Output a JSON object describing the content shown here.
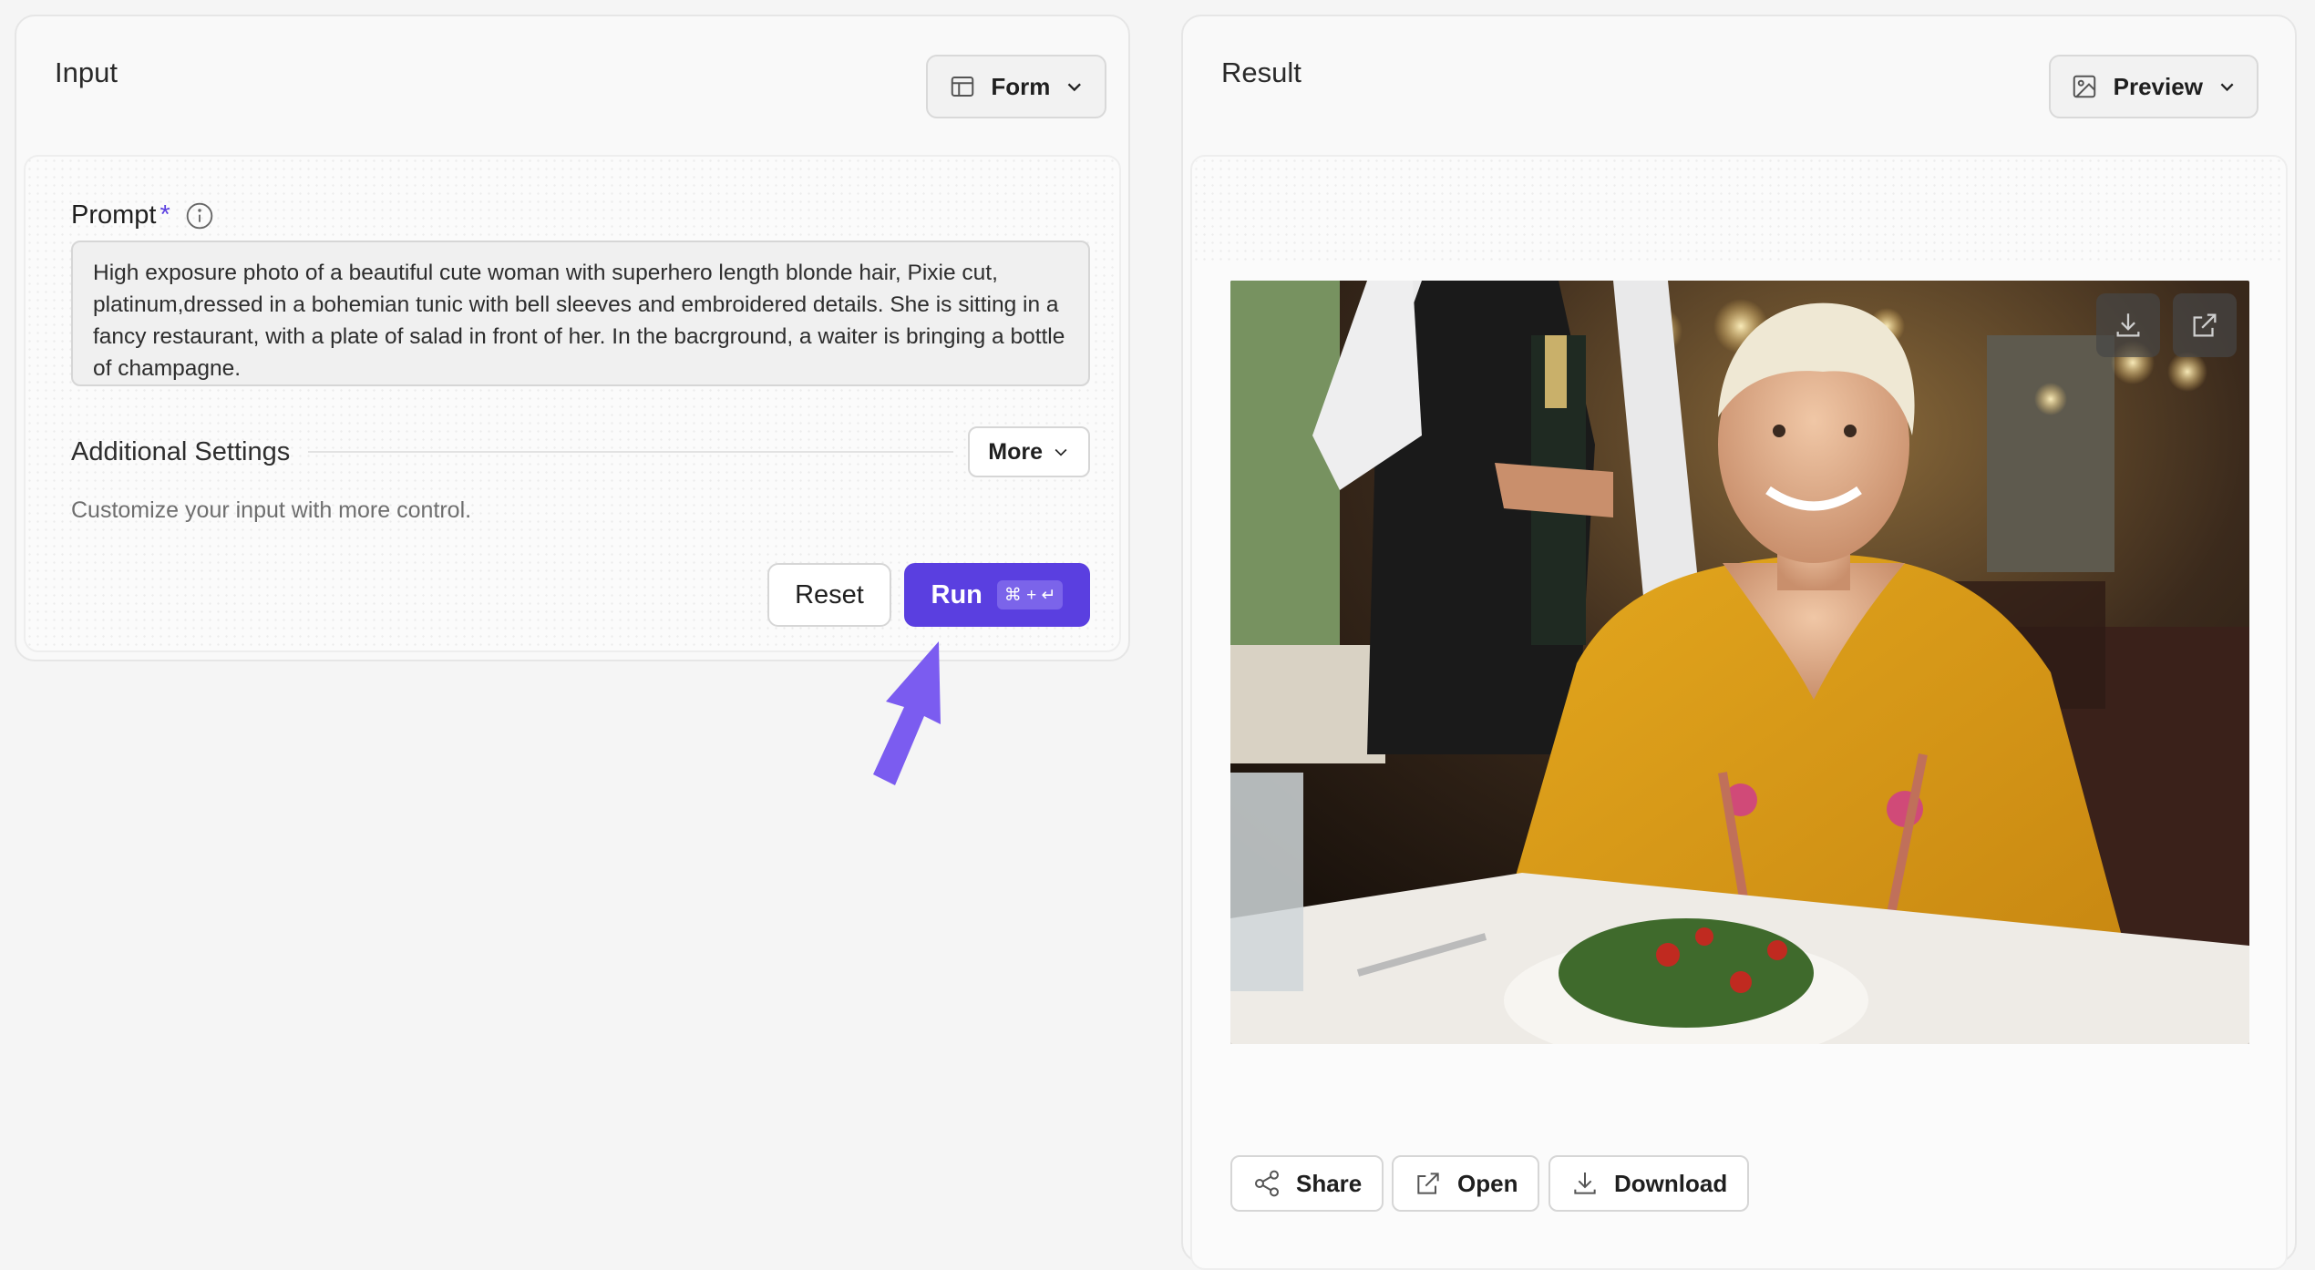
{
  "input_panel": {
    "title": "Input",
    "mode_label": "Form",
    "prompt_label": "Prompt",
    "required_mark": "*",
    "prompt_text": "High exposure photo of a beautiful cute woman with superhero length blonde hair, Pixie cut, platinum,dressed in a bohemian tunic with bell sleeves and embroidered details. She is sitting in a fancy restaurant, with a plate of salad in front of her. In the bacrground, a waiter is bringing a bottle of champagne.",
    "settings_title": "Additional Settings",
    "more_label": "More",
    "settings_subtitle": "Customize your input with more control.",
    "reset_label": "Reset",
    "run_label": "Run",
    "run_shortcut": "⌘ + ↵"
  },
  "result_panel": {
    "title": "Result",
    "mode_label": "Preview",
    "actions": [
      "Share",
      "Open",
      "Download"
    ]
  },
  "colors": {
    "accent": "#5a3fe0",
    "arrow": "#7b5cf0"
  },
  "icons": [
    "form-layout-icon",
    "chevron-down-icon",
    "info-icon",
    "image-icon",
    "download-icon",
    "external-link-icon",
    "share-icon",
    "pointer-arrow-icon"
  ]
}
